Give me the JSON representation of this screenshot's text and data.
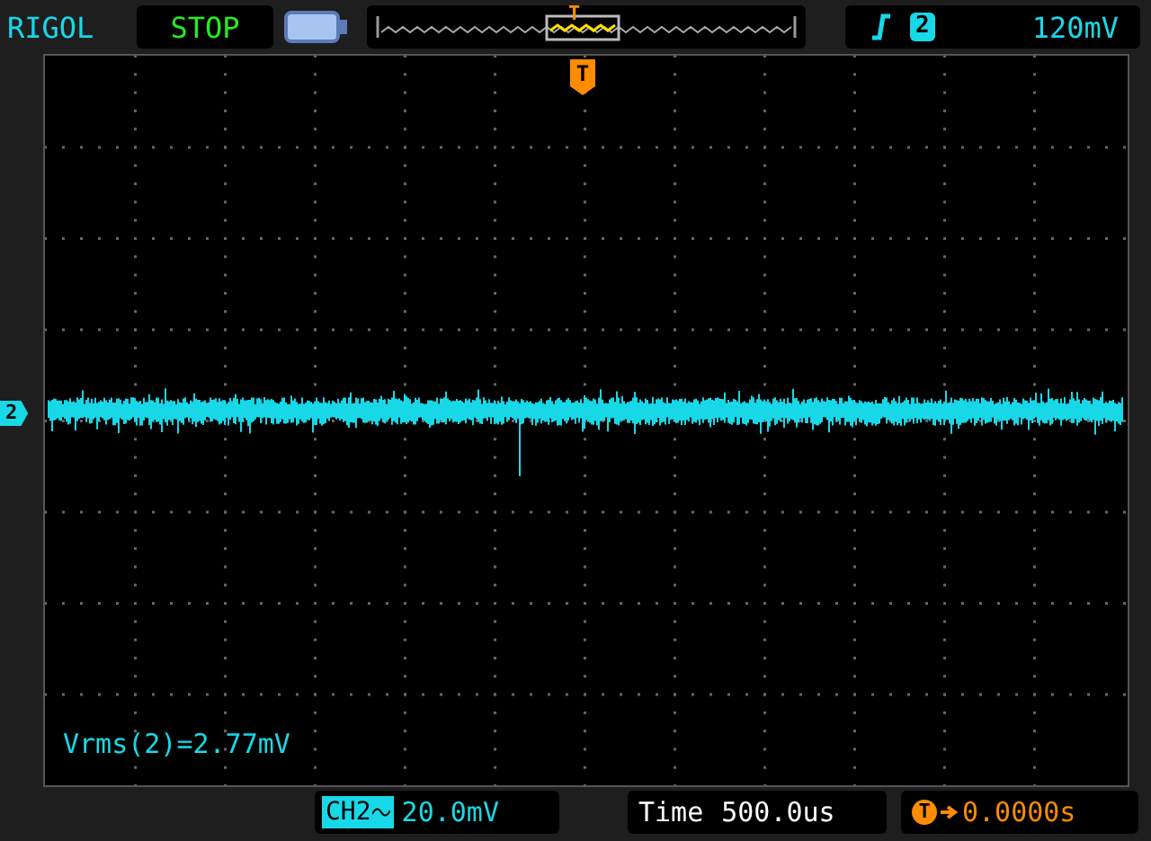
{
  "brand": "RIGOL",
  "run_state": "STOP",
  "memory_bar": {
    "trigger_marker": "T"
  },
  "trigger": {
    "channel": "2",
    "level": "120mV"
  },
  "screen": {
    "trigger_marker": "T",
    "channel_marker": "2",
    "measurement": "Vrms(2)=2.77mV"
  },
  "bottom_bar": {
    "channel": "CH2",
    "volts_per_div": "20.0mV",
    "time_label": "Time",
    "time_per_div": "500.0us",
    "trigger_marker": "T",
    "trigger_offset": "0.0000s"
  }
}
